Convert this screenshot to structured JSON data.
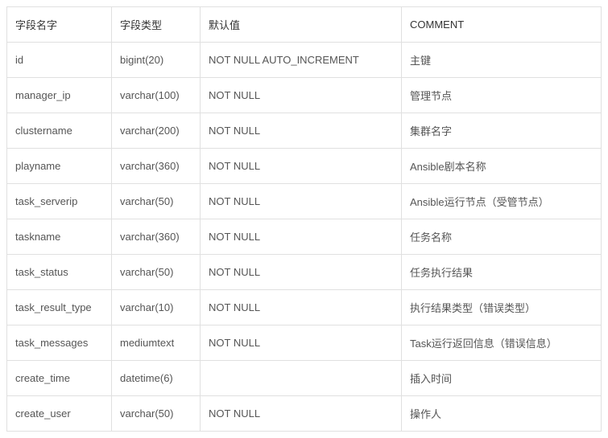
{
  "headers": {
    "field_name": "字段名字",
    "field_type": "字段类型",
    "default_value": "默认值",
    "comment": "COMMENT"
  },
  "rows": [
    {
      "field_name": "id",
      "field_type": "bigint(20)",
      "default_value": "NOT NULL AUTO_INCREMENT",
      "comment": "主键"
    },
    {
      "field_name": "manager_ip",
      "field_type": "varchar(100)",
      "default_value": "NOT NULL",
      "comment": "管理节点"
    },
    {
      "field_name": "clustername",
      "field_type": "varchar(200)",
      "default_value": "NOT NULL",
      "comment": "集群名字"
    },
    {
      "field_name": "playname",
      "field_type": "varchar(360)",
      "default_value": "NOT NULL",
      "comment": "Ansible剧本名称"
    },
    {
      "field_name": "task_serverip",
      "field_type": "varchar(50)",
      "default_value": "NOT NULL",
      "comment": "Ansible运行节点（受管节点）"
    },
    {
      "field_name": "taskname",
      "field_type": "varchar(360)",
      "default_value": "NOT NULL",
      "comment": "任务名称"
    },
    {
      "field_name": "task_status",
      "field_type": "varchar(50)",
      "default_value": "NOT NULL",
      "comment": "任务执行结果"
    },
    {
      "field_name": "task_result_type",
      "field_type": "varchar(10)",
      "default_value": "NOT NULL",
      "comment": "执行结果类型（错误类型）"
    },
    {
      "field_name": "task_messages",
      "field_type": "mediumtext",
      "default_value": "NOT NULL",
      "comment": "Task运行返回信息（错误信息）"
    },
    {
      "field_name": "create_time",
      "field_type": "datetime(6)",
      "default_value": "",
      "comment": "插入时间"
    },
    {
      "field_name": "create_user",
      "field_type": "varchar(50)",
      "default_value": "NOT NULL",
      "comment": "操作人"
    }
  ]
}
